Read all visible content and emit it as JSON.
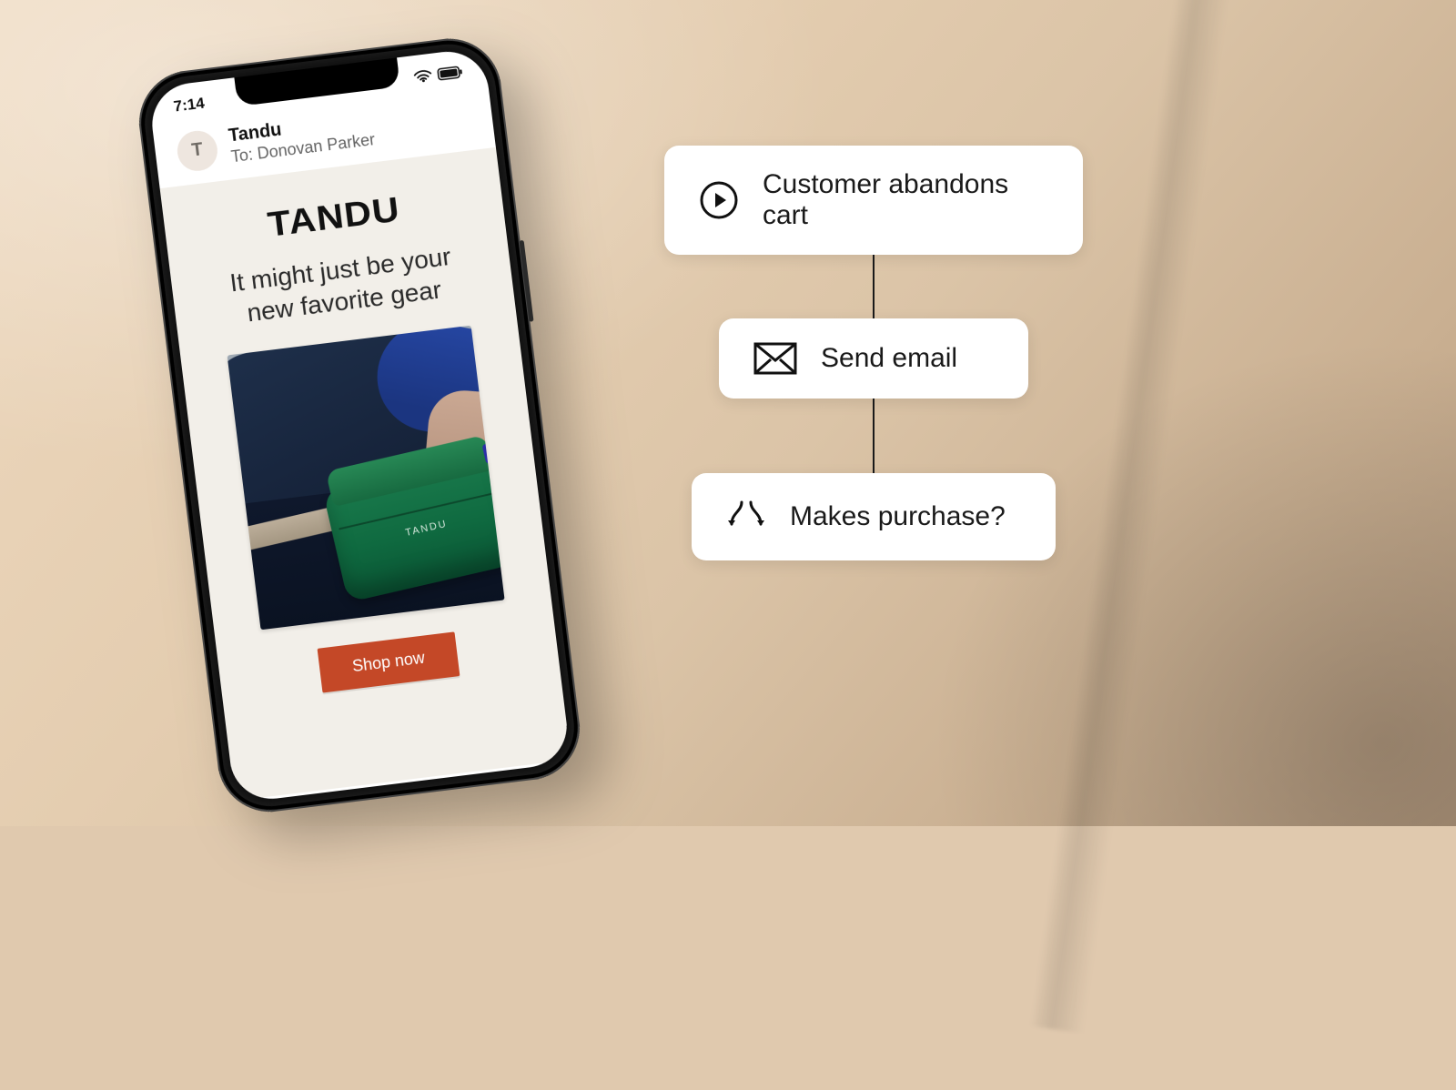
{
  "phone": {
    "status": {
      "time": "7:14"
    },
    "email": {
      "avatar_initial": "T",
      "from": "Tandu",
      "to_prefix": "To: ",
      "to_name": "Donovan Parker",
      "brand": "TANDU",
      "headline": "It might just be your new favorite gear",
      "product_bag_label": "TANDU",
      "cta": "Shop now"
    }
  },
  "flow": {
    "steps": [
      {
        "icon": "play-icon",
        "label": "Customer abandons cart"
      },
      {
        "icon": "mail-icon",
        "label": "Send email"
      },
      {
        "icon": "branch-icon",
        "label": "Makes purchase?"
      }
    ]
  }
}
